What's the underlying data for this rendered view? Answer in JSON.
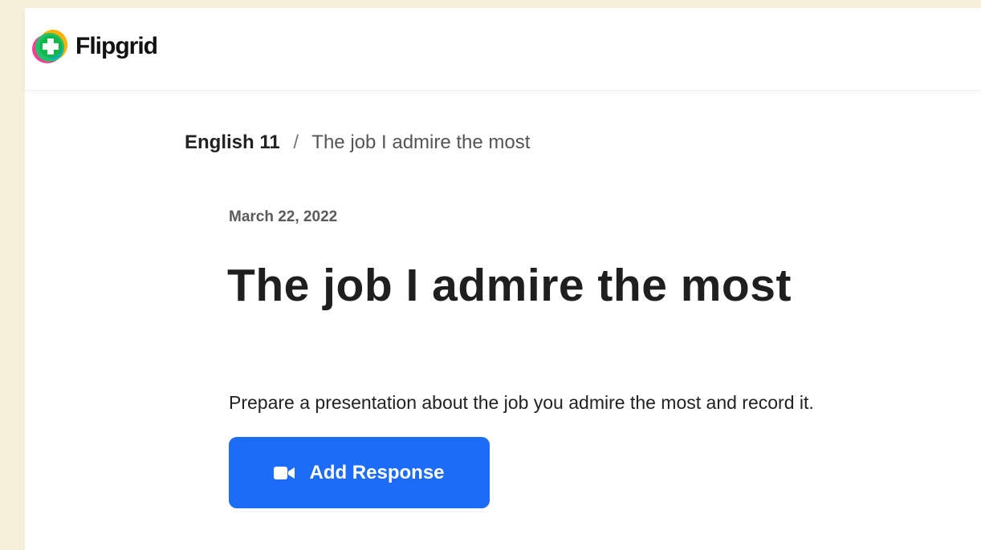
{
  "app": {
    "logo_text": "Flipgrid",
    "logo_icon": "flipgrid-logo-icon",
    "accent": "#1c6cf5"
  },
  "breadcrumb": {
    "course": "English 11",
    "separator": "/",
    "current": "The job I admire the most"
  },
  "topic": {
    "date": "March 22, 2022",
    "title": "The job I admire the most",
    "prompt": "Prepare a presentation about the job you admire the most and record it."
  },
  "actions": {
    "add_response_label": "Add Response",
    "add_response_icon": "video-camera-icon"
  }
}
